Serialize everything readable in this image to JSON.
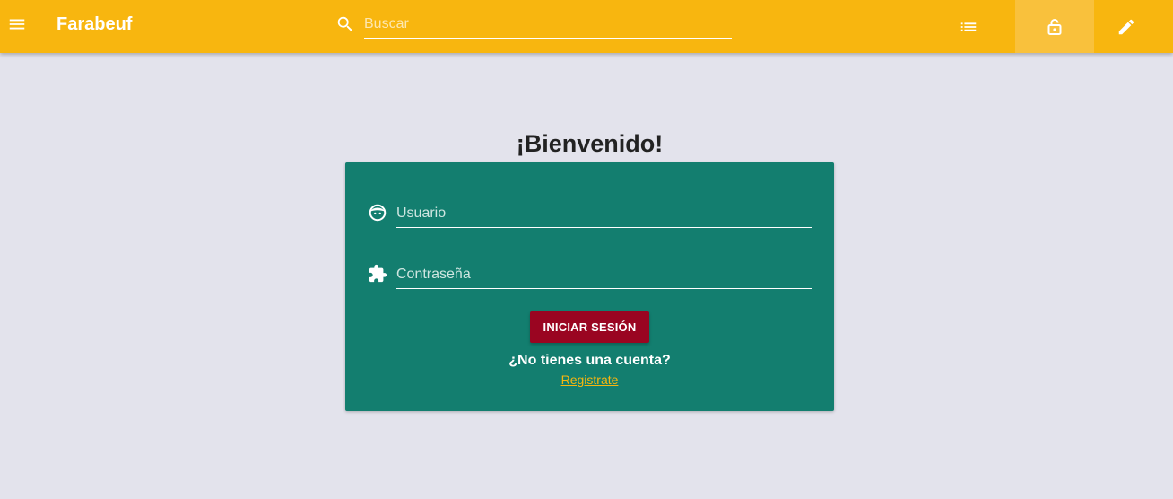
{
  "topbar": {
    "menu_icon": "menu-icon",
    "brand": "Farabeuf",
    "search": {
      "icon": "search-icon",
      "placeholder": "Buscar",
      "value": ""
    },
    "nav": [
      {
        "icon": "list-icon"
      },
      {
        "icon": "lock-open-icon",
        "active": true
      },
      {
        "icon": "pencil-icon"
      }
    ]
  },
  "login": {
    "heading": "¡Bienvenido!",
    "username": {
      "icon": "face-icon",
      "placeholder": "Usuario",
      "value": ""
    },
    "password": {
      "icon": "puzzle-icon",
      "placeholder": "Contraseña",
      "value": ""
    },
    "submit_label": "INICIAR SESIÓN",
    "no_account_text": "¿No tienes una cuenta?",
    "register_label": "Registrate"
  },
  "colors": {
    "topbar": "#f8b60f",
    "active_nav": "#f9c13c",
    "background": "#e3e3ec",
    "card": "#137e6f",
    "primary_button": "#9a0521",
    "link": "#f8b60f"
  }
}
